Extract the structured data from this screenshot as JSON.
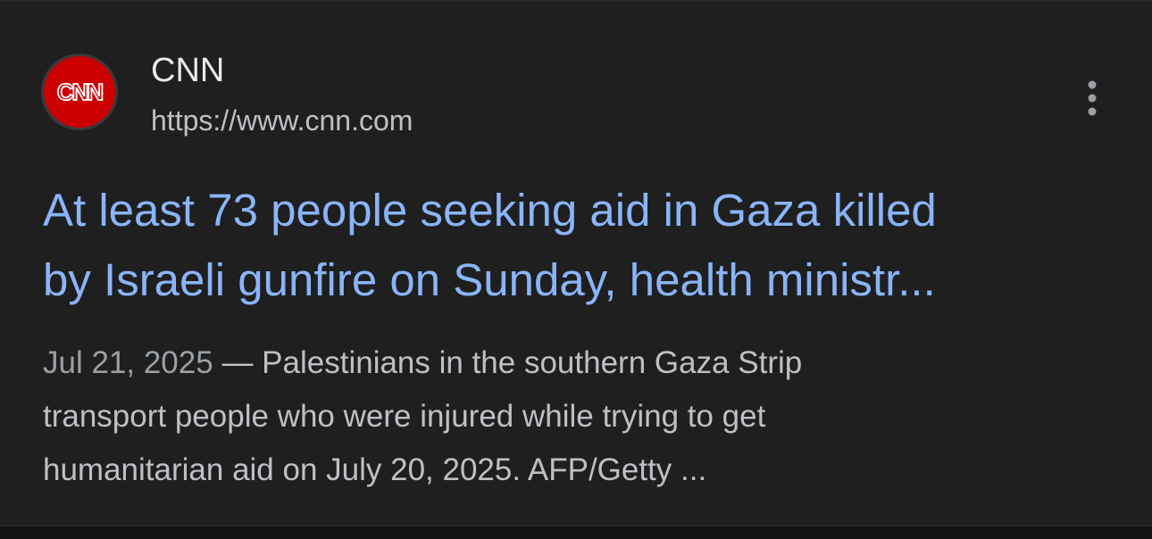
{
  "result": {
    "site_name": "CNN",
    "site_url": "https://www.cnn.com",
    "favicon_text": "CNN",
    "headline_line1": "At least 73 people seeking aid in Gaza killed",
    "headline_line2": "by Israeli gunfire on Sunday, health ministr...",
    "date": "Jul 21, 2025",
    "separator": " — ",
    "snippet_line1": "Palestinians in the southern Gaza Strip",
    "snippet_line2": "transport people who were injured while trying to get",
    "snippet_line3": "humanitarian aid on July 20, 2025. AFP/Getty ..."
  },
  "icons": {
    "favicon": "cnn-logo-icon",
    "more": "more-vert-icon"
  },
  "colors": {
    "background": "#1f1f1f",
    "headline": "#8ab4f8",
    "brand": "#cc0000",
    "text_primary": "#e8eaed",
    "text_secondary": "#bdc1c6"
  }
}
